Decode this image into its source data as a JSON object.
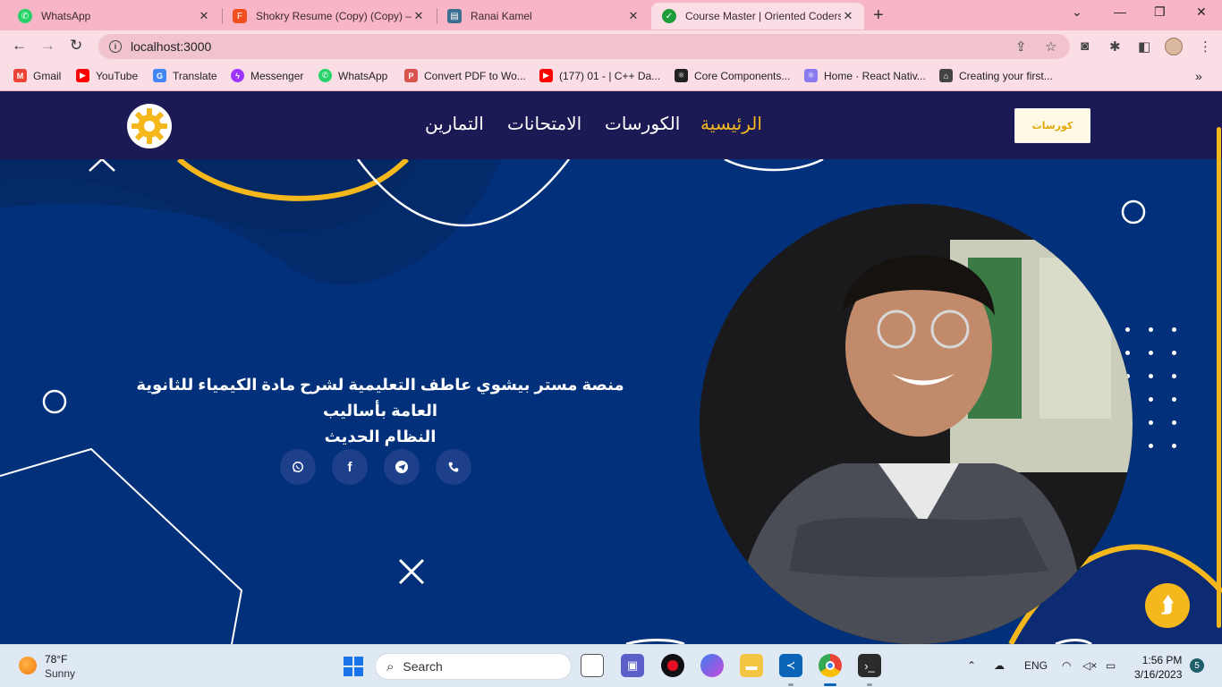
{
  "browser": {
    "tabs": [
      {
        "title": "WhatsApp",
        "icon": "whatsapp-icon",
        "color": "#25d366",
        "active": false
      },
      {
        "title": "Shokry Resume (Copy) (Copy) – F",
        "icon": "figma-icon",
        "color": "#f24e1e",
        "active": false
      },
      {
        "title": "Ranai Kamel",
        "icon": "terminal-icon",
        "color": "#3c6e8f",
        "active": false
      },
      {
        "title": "Course Master | Oriented Coders",
        "icon": "check-circle-icon",
        "color": "#1e9e3a",
        "active": true
      }
    ],
    "new_tab": "+",
    "url": "localhost:3000",
    "bookmarks": [
      {
        "label": "Gmail",
        "icon": "gmail-icon",
        "color": "#ea4335"
      },
      {
        "label": "YouTube",
        "icon": "youtube-icon",
        "color": "#ff0000"
      },
      {
        "label": "Translate",
        "icon": "translate-icon",
        "color": "#4285f4"
      },
      {
        "label": "Messenger",
        "icon": "messenger-icon",
        "color": "#a033ff"
      },
      {
        "label": "WhatsApp",
        "icon": "whatsapp-icon",
        "color": "#25d366"
      },
      {
        "label": "Convert PDF to Wo...",
        "icon": "pdf-icon",
        "color": "#d9534f"
      },
      {
        "label": "(177) 01 - | C++ Da...",
        "icon": "youtube-icon",
        "color": "#ff0000"
      },
      {
        "label": "Core Components...",
        "icon": "react-icon",
        "color": "#222222"
      },
      {
        "label": "Home · React Nativ...",
        "icon": "react-native-icon",
        "color": "#8a7cf0"
      },
      {
        "label": "Creating your first...",
        "icon": "docs-icon",
        "color": "#444444"
      }
    ]
  },
  "site": {
    "nav": {
      "items": [
        {
          "label": "الرئيسية",
          "active": true
        },
        {
          "label": "الكورسات",
          "active": false
        },
        {
          "label": "الامتحانات",
          "active": false
        },
        {
          "label": "التمارين",
          "active": false
        }
      ],
      "brand_text": "كورسات",
      "accent": "#f5b81c",
      "nav_bg": "#1c1a55"
    },
    "hero": {
      "line1": "منصة مستر بيشوي عاطف التعليمية لشرح مادة الكيمياء للثانوية العامة بأساليب",
      "line2": "النظام الحديث",
      "bg": "#02307a"
    },
    "social": [
      {
        "name": "whatsapp-icon"
      },
      {
        "name": "facebook-icon"
      },
      {
        "name": "telegram-icon"
      },
      {
        "name": "phone-icon"
      }
    ],
    "scroll_top": "⮭"
  },
  "taskbar": {
    "temp": "78°F",
    "condition": "Sunny",
    "search_placeholder": "Search",
    "lang": "ENG",
    "time": "1:56 PM",
    "date": "3/16/2023",
    "notifications": "5"
  }
}
